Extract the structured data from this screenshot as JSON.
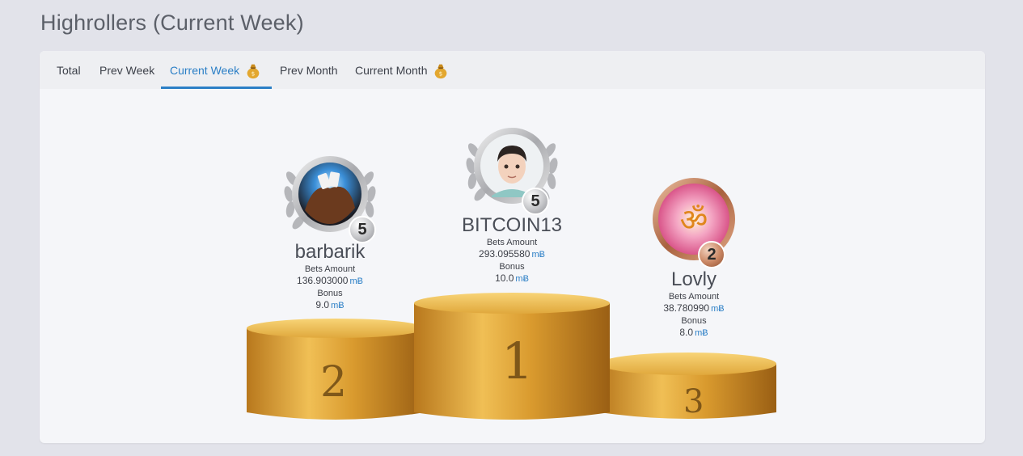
{
  "page": {
    "title": "Highrollers (Current Week)"
  },
  "tabs": [
    {
      "label": "Total",
      "active": false,
      "icon": null
    },
    {
      "label": "Prev Week",
      "active": false,
      "icon": null
    },
    {
      "label": "Current Week",
      "active": true,
      "icon": "money-bag-icon"
    },
    {
      "label": "Prev Month",
      "active": false,
      "icon": null
    },
    {
      "label": "Current Month",
      "active": false,
      "icon": "money-bag-icon"
    }
  ],
  "podium": {
    "first": {
      "place": "1",
      "name": "BITCOIN13",
      "level": "5",
      "bets_label": "Bets Amount",
      "bets_amount": "293.095580",
      "bonus_label": "Bonus",
      "bonus": "10.0",
      "currency": "mɃ",
      "frame": "silver"
    },
    "second": {
      "place": "2",
      "name": "barbarik",
      "level": "5",
      "bets_label": "Bets Amount",
      "bets_amount": "136.903000",
      "bonus_label": "Bonus",
      "bonus": "9.0",
      "currency": "mɃ",
      "frame": "silver"
    },
    "third": {
      "place": "3",
      "name": "Lovly",
      "level": "2",
      "bets_label": "Bets Amount",
      "bets_amount": "38.780990",
      "bonus_label": "Bonus",
      "bonus": "8.0",
      "currency": "mɃ",
      "frame": "bronze"
    }
  },
  "colors": {
    "accent": "#2b7fc6",
    "gold": "#d9a233",
    "background": "#e2e3ea",
    "card": "#f5f6f9"
  }
}
